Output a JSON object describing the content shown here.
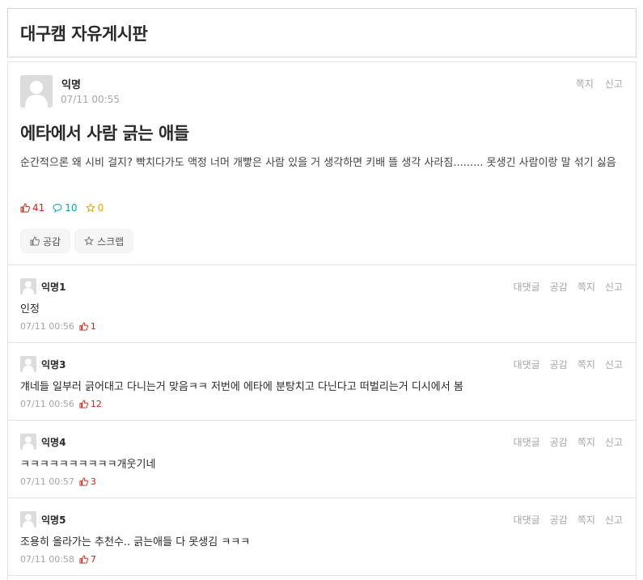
{
  "board": {
    "title": "대구캠 자유게시판"
  },
  "post": {
    "author": "익명",
    "time": "07/11 00:55",
    "actions": {
      "message": "쪽지",
      "report": "신고"
    },
    "title": "에타에서 사람 긁는 애들",
    "body": "순간적으론 왜 시비 걸지? 빡치다가도 액정 너머 개빻은 사람 있을 거 생각하면 키배 뜰 생각 사라짐......... 못생긴 사람이랑 말 섞기 싫음",
    "stats": {
      "votes": "41",
      "comments": "10",
      "scraps": "0"
    },
    "buttons": {
      "vote": "공감",
      "scrap": "스크랩"
    }
  },
  "comment_actions": {
    "reply": "대댓글",
    "vote": "공감",
    "message": "쪽지",
    "report": "신고"
  },
  "comments": [
    {
      "author": "익명1",
      "text": "인정",
      "time": "07/11 00:56",
      "votes": "1"
    },
    {
      "author": "익명3",
      "text": "걔네들 일부러 긁어대고 다니는거 맞음ㅋㅋ 저번에 에타에 분탕치고 다닌다고 떠벌리는거 디시에서 봄",
      "time": "07/11 00:56",
      "votes": "12"
    },
    {
      "author": "익명4",
      "text": "ㅋㅋㅋㅋㅋㅋㅋㅋㅋㅋ개웃기네",
      "time": "07/11 00:57",
      "votes": "3"
    },
    {
      "author": "익명5",
      "text": "조용히 올라가는 추천수.. 긁는애들 다 못생김 ㅋㅋㅋ",
      "time": "07/11 00:58",
      "votes": "7"
    }
  ],
  "icons": {
    "avatar": "default-user-avatar",
    "vote": "thumbs-up-icon",
    "comment": "speech-bubble-icon",
    "scrap": "star-icon"
  },
  "colors": {
    "vote": "#c62917",
    "comment": "#0ca5af",
    "scrap": "#f0a500",
    "muted": "#a6a6a6"
  }
}
